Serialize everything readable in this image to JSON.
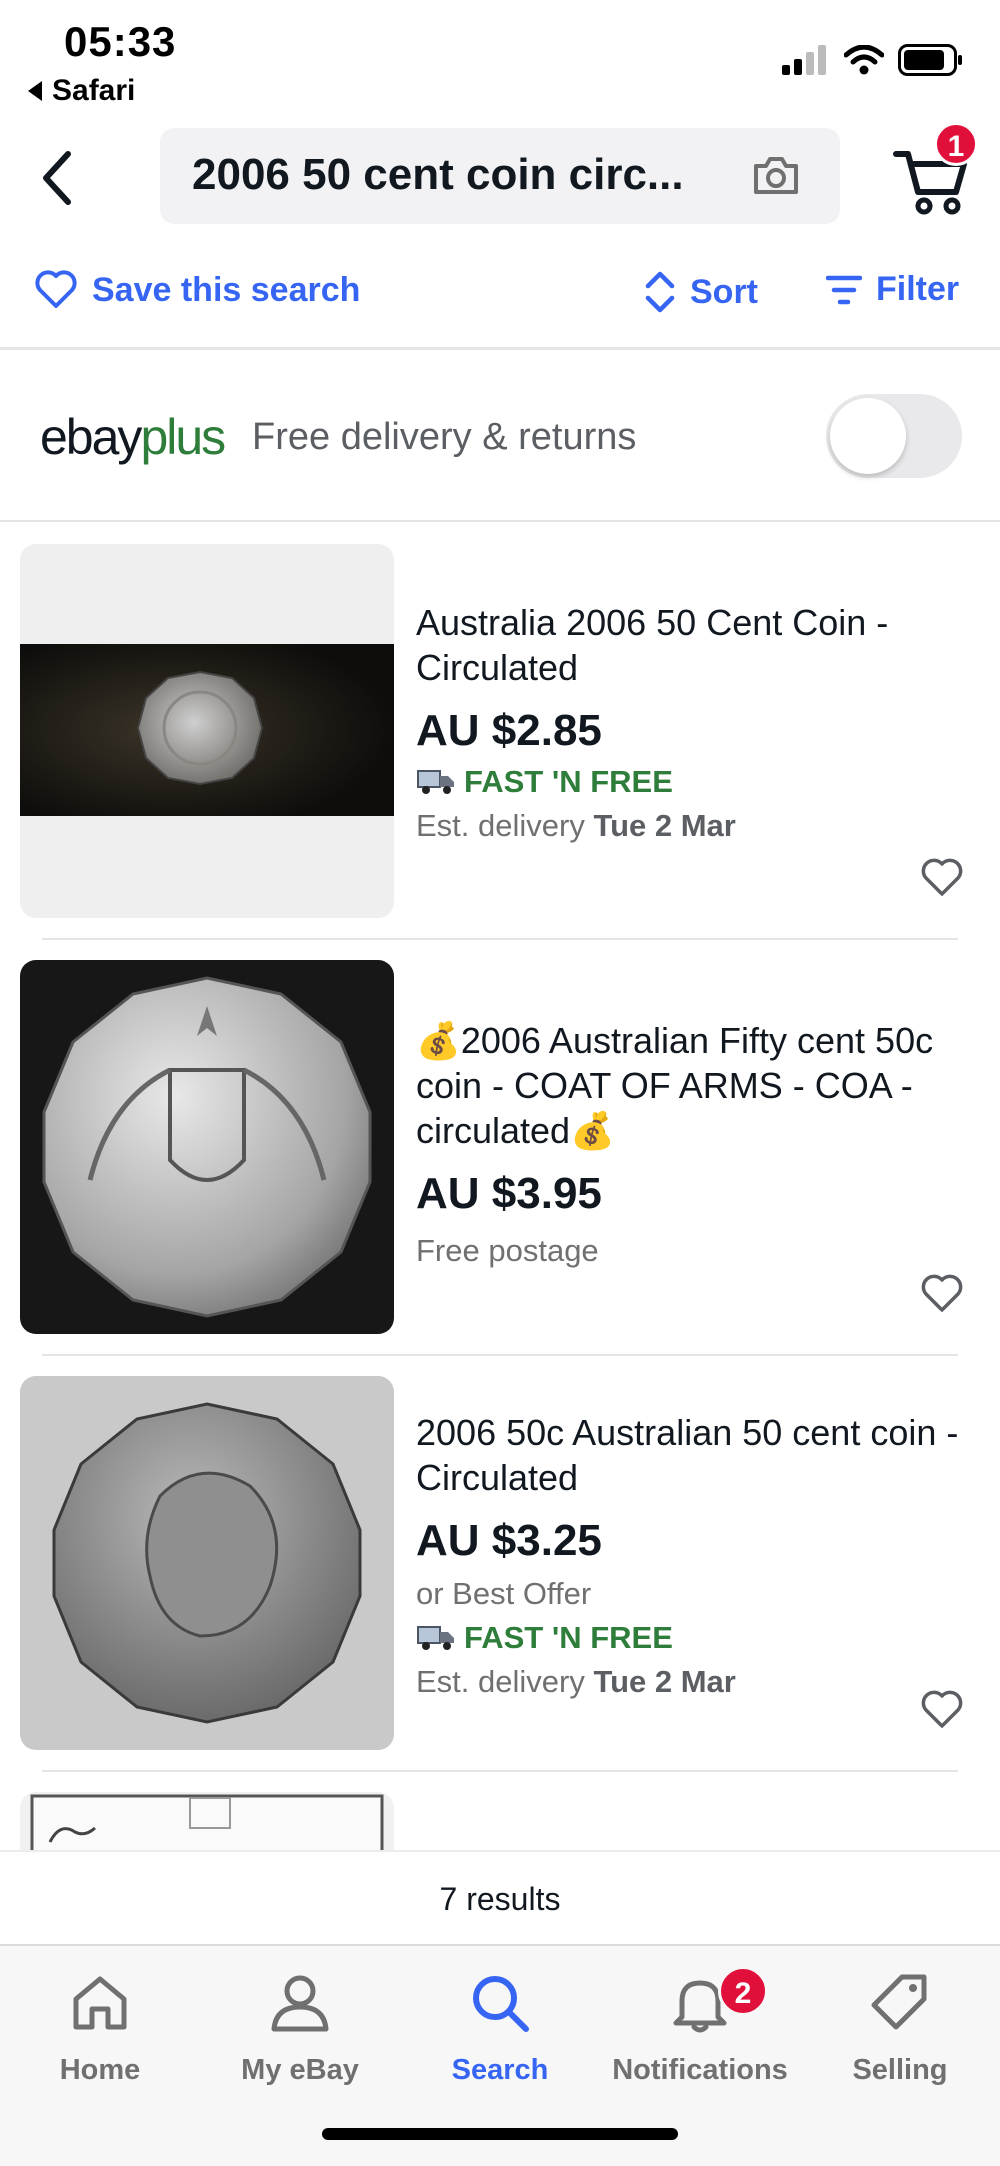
{
  "status_bar": {
    "time": "05:33",
    "back_app": "Safari",
    "icons": [
      "signal-icon",
      "wifi-icon",
      "battery-icon"
    ]
  },
  "header": {
    "search_query": "2006 50 cent coin circ...",
    "cart_count": "1"
  },
  "actions": {
    "save_label": "Save this search",
    "sort_label": "Sort",
    "filter_label": "Filter"
  },
  "ebay_plus": {
    "logo_ebay": "ebay",
    "logo_plus": "plus",
    "text": "Free delivery & returns",
    "toggle_on": false
  },
  "listings": [
    {
      "title": "Australia 2006 50 Cent Coin - Circulated",
      "price": "AU $2.85",
      "fast_label": "FAST 'N FREE",
      "delivery_prefix": "Est. delivery ",
      "delivery_date": "Tue 2 Mar"
    },
    {
      "title": "💰2006 Australian Fifty cent 50c coin - COAT OF ARMS - COA - circulated💰",
      "price": "AU $3.95",
      "shipping": "Free postage"
    },
    {
      "title": "2006 50c Australian 50 cent coin - Circulated",
      "price": "AU $3.25",
      "offer": "or Best Offer",
      "fast_label": "FAST 'N FREE",
      "delivery_prefix": "Est. delivery ",
      "delivery_date": "Tue 2 Mar"
    }
  ],
  "results": "7 results",
  "nav": {
    "home": "Home",
    "my_ebay": "My eBay",
    "search": "Search",
    "notifications": "Notifications",
    "notifications_count": "2",
    "selling": "Selling"
  },
  "colors": {
    "accent": "#3665f3",
    "badge": "#e0103a",
    "fast_green": "#2f7d3a"
  }
}
